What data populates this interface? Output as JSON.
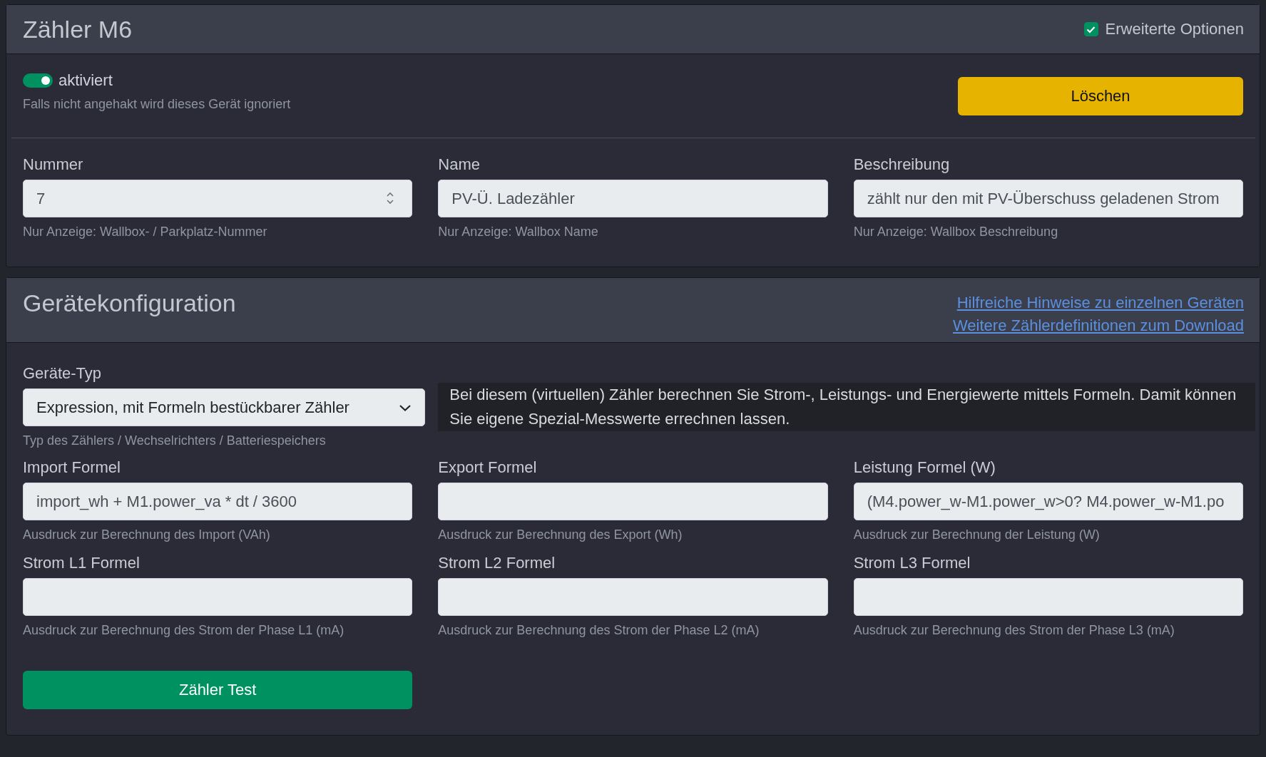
{
  "meter_card": {
    "title": "Zähler M6",
    "advanced_options": {
      "label": "Erweiterte Optionen",
      "checked": true
    },
    "enabled": {
      "label": "aktiviert",
      "on": true,
      "help": "Falls nicht angehakt wird dieses Gerät ignoriert"
    },
    "delete_button": "Löschen",
    "fields": [
      {
        "kind": "number",
        "label": "Nummer",
        "value": "7",
        "help": "Nur Anzeige: Wallbox- / Parkplatz-Nummer"
      },
      {
        "kind": "text",
        "label": "Name",
        "value": "PV-Ü. Ladezähler",
        "help": "Nur Anzeige: Wallbox Name"
      },
      {
        "kind": "text",
        "label": "Beschreibung",
        "value": "zählt nur den mit PV-Überschuss geladenen Strom",
        "help": "Nur Anzeige: Wallbox Beschreibung"
      }
    ]
  },
  "config_card": {
    "title": "Gerätekonfiguration",
    "links": [
      "Hilfreiche Hinweise zu einzelnen Geräten",
      "Weitere Zählerdefinitionen zum Download"
    ],
    "device_type": {
      "label": "Geräte-Typ",
      "value": "Expression, mit Formeln bestückbarer Zähler",
      "help": "Typ des Zählers / Wechselrichters / Batteriespeichers"
    },
    "info": "Bei diesem (virtuellen) Zähler berechnen Sie Strom-, Leistungs- und Energiewerte mittels Formeln. Damit können Sie eigene Spezial-Messwerte errechnen lassen.",
    "formulas": [
      {
        "label": "Import Formel",
        "value": "import_wh + M1.power_va * dt / 3600",
        "help": "Ausdruck zur Berechnung des Import (VAh)"
      },
      {
        "label": "Export Formel",
        "help": "Ausdruck zur Berechnung des Export (Wh)"
      },
      {
        "label": "Leistung Formel (W)",
        "value": "(M4.power_w-M1.power_w>0? M4.power_w-M1.po",
        "help": "Ausdruck zur Berechnung der Leistung (W)"
      },
      {
        "label": "Strom L1 Formel",
        "help": "Ausdruck zur Berechnung des Strom der Phase L1 (mA)"
      },
      {
        "label": "Strom L2 Formel",
        "help": "Ausdruck zur Berechnung des Strom der Phase L2 (mA)"
      },
      {
        "label": "Strom L3 Formel",
        "help": "Ausdruck zur Berechnung des Strom der Phase L3 (mA)"
      }
    ],
    "test_button": "Zähler Test"
  }
}
